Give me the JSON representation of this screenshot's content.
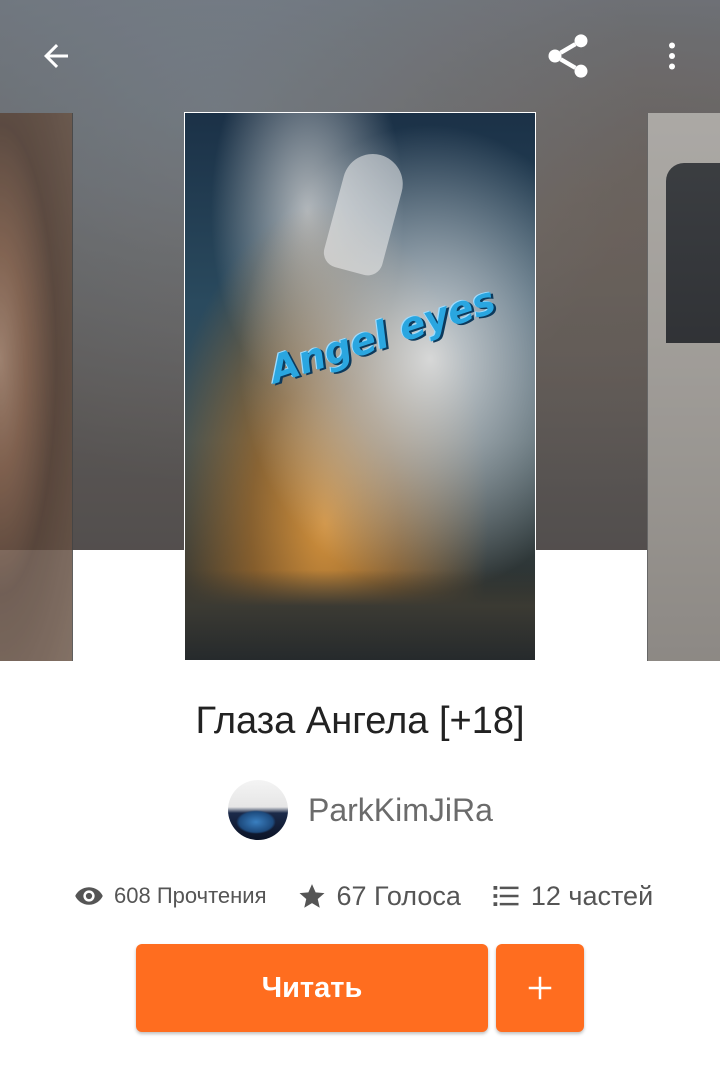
{
  "toolbar": {
    "back_icon": "arrow-left-icon",
    "share_icon": "share-icon",
    "more_icon": "more-vertical-icon"
  },
  "cover": {
    "title_text": "Angel eyes"
  },
  "book": {
    "title": "Глаза Ангела [+18]",
    "author": "ParkKimJiRa"
  },
  "stats": {
    "reads": "608 Прочтения",
    "votes": "67 Голоса",
    "parts": "12 частей"
  },
  "actions": {
    "read_label": "Читать",
    "add_icon": "plus-icon"
  },
  "colors": {
    "accent": "#ff6d1f",
    "title_text": "#222222",
    "secondary_text": "#555555"
  }
}
